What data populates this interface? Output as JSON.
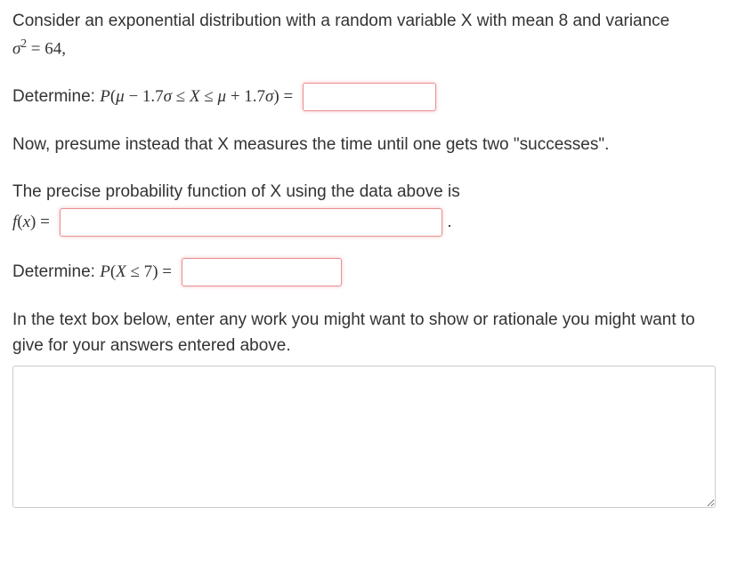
{
  "intro": {
    "text1": "Consider an exponential distribution with a random variable X with mean 8 and variance",
    "sigma_sq": "σ",
    "sigma_exp": "2",
    "equals64": " = 64,"
  },
  "q1": {
    "label": "Determine: ",
    "P": "P",
    "open": "(",
    "mu1": "μ",
    "minus": " − 1.7",
    "sigma1": "σ",
    "le1": " ≤ ",
    "X": "X",
    "le2": " ≤ ",
    "mu2": "μ",
    "plus": " + 1.7",
    "sigma2": "σ",
    "close": ") =",
    "value": ""
  },
  "q2": {
    "text": "Now, presume instead that X measures the time until one gets two \"successes\"."
  },
  "q3": {
    "text": "The precise probability function of X using the data above is",
    "f": "f",
    "open": "(",
    "x": "x",
    "close": ") =",
    "value": "",
    "period": "."
  },
  "q4": {
    "label": "Determine: ",
    "P": "P",
    "open": "(",
    "X": "X",
    "le": " ≤ 7",
    "close": ") =",
    "value": ""
  },
  "q5": {
    "text": "In the text box below, enter any work you might want to show or rationale you might want to give for your answers entered above.",
    "value": ""
  }
}
